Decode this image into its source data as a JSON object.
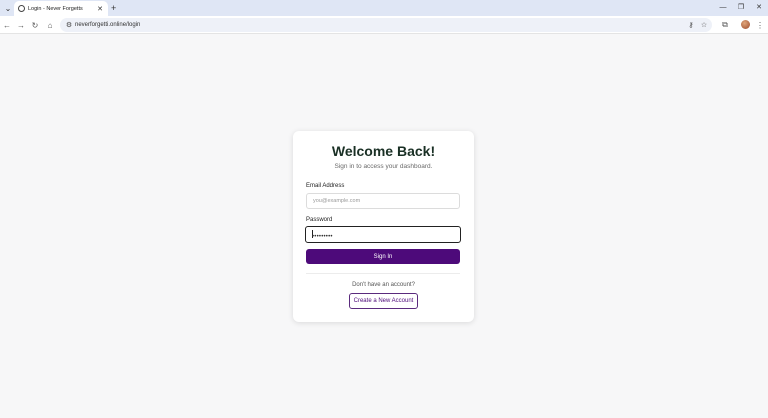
{
  "browser": {
    "tab": {
      "title": "Login - Never Forgetts",
      "favicon": "globe-icon"
    },
    "url": "neverforgetti.online/login",
    "icons": {
      "back": "←",
      "forward": "→",
      "reload": "↻",
      "home": "⌂",
      "site_info": "⚙",
      "passwords": "⚷",
      "bookmark": "☆",
      "extensions": "⧉",
      "menu": "⋮",
      "tab_search": "⌄",
      "tab_close": "✕",
      "new_tab": "+",
      "minimize": "—",
      "restore": "❐",
      "close": "✕"
    }
  },
  "login": {
    "title": "Welcome Back!",
    "subtitle": "Sign in to access your dashboard.",
    "email_label": "Email Address",
    "email_placeholder": "you@example.com",
    "email_value": "",
    "password_label": "Password",
    "password_value": "•••••••••",
    "signin_label": "Sign In",
    "no_account_text": "Don't have an account?",
    "create_label": "Create a New Account"
  },
  "colors": {
    "primary": "#4d0a7a",
    "heading": "#1a3025",
    "page_bg": "#f7f7f8"
  }
}
